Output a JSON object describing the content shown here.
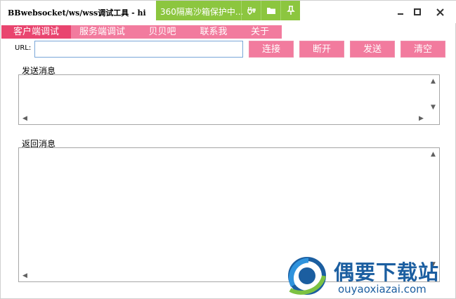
{
  "window": {
    "title": "BBwebsocket/ws/wss调试工具 - hi",
    "sandbox_text": "360隔离沙箱保护中..."
  },
  "menu": {
    "tabs": [
      {
        "label": "客户端调试",
        "active": true
      },
      {
        "label": "服务端调试",
        "active": false
      },
      {
        "label": "贝贝吧",
        "active": false
      },
      {
        "label": "联系我",
        "active": false
      },
      {
        "label": "关于",
        "active": false
      }
    ]
  },
  "url_row": {
    "label": "URL:",
    "value": "",
    "buttons": {
      "connect": "连接",
      "disconnect": "断开",
      "send": "发送",
      "clear": "清空"
    }
  },
  "send_panel": {
    "label": "发送消息",
    "content": ""
  },
  "receive_panel": {
    "label": "返回消息",
    "content": ""
  },
  "watermark": {
    "name": "偶要下载站",
    "domain": "ouyaoxiazai.com"
  },
  "colors": {
    "accent": "#f27b9e",
    "accent_active": "#e9456f",
    "sandbox": "#8cc63f",
    "watermark": "#1b5ea0"
  }
}
